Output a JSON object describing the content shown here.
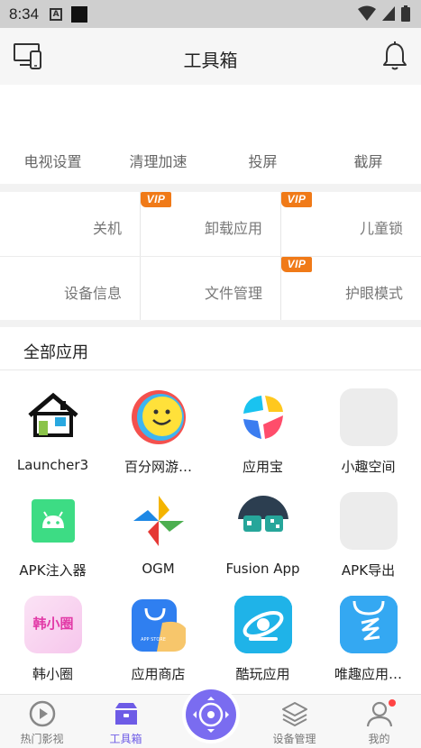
{
  "status_bar": {
    "time": "8:34",
    "a_label": "A"
  },
  "header": {
    "title": "工具箱"
  },
  "tv_row": [
    "电视设置",
    "清理加速",
    "投屏",
    "截屏"
  ],
  "vip_label": "VIP",
  "grid": [
    {
      "label": "关机",
      "vip": false
    },
    {
      "label": "卸载应用",
      "vip": true
    },
    {
      "label": "儿童锁",
      "vip": true
    },
    {
      "label": "设备信息",
      "vip": false
    },
    {
      "label": "文件管理",
      "vip": false
    },
    {
      "label": "护眼模式",
      "vip": true
    }
  ],
  "apps": {
    "title": "全部应用",
    "items": [
      {
        "name": "Launcher3",
        "icon": "launcher3-icon"
      },
      {
        "name": "百分网游…",
        "icon": "baifen-game-icon"
      },
      {
        "name": "应用宝",
        "icon": "yingyongbao-icon"
      },
      {
        "name": "小趣空间",
        "icon": "xiaoqu-space-icon"
      },
      {
        "name": "APK注入器",
        "icon": "apk-injector-icon"
      },
      {
        "name": "OGM",
        "icon": "ogm-icon"
      },
      {
        "name": "Fusion App",
        "icon": "fusion-app-icon"
      },
      {
        "name": "APK导出",
        "icon": "apk-export-icon"
      },
      {
        "name": "韩小圈",
        "icon": "hanxiaoquan-icon",
        "icon_text": "韩小圈"
      },
      {
        "name": "应用商店",
        "icon": "app-store-icon",
        "icon_text": "APP STORE"
      },
      {
        "name": "酷玩应用",
        "icon": "kuwan-app-icon"
      },
      {
        "name": "唯趣应用…",
        "icon": "weiqu-app-icon"
      }
    ]
  },
  "bottom_nav": [
    {
      "label": "热门影视",
      "active": false
    },
    {
      "label": "工具箱",
      "active": true
    },
    {
      "label": "设备管理",
      "active": false
    },
    {
      "label": "我的",
      "active": false
    }
  ],
  "colors": {
    "accent": "#6d5be6",
    "vip": "#f07a18",
    "remote": "#7a6cf0"
  }
}
